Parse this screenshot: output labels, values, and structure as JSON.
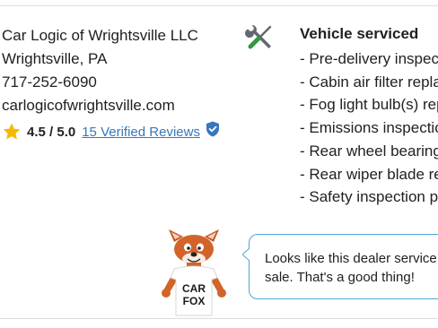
{
  "dealer": {
    "name": "Car Logic of Wrightsville LLC",
    "location": "Wrightsville, PA",
    "phone": "717-252-6090",
    "website": "carlogicofwrightsville.com",
    "rating": "4.5 / 5.0",
    "reviews_link": "15 Verified Reviews",
    "star_color": "#f5b800",
    "link_color": "#3777bc"
  },
  "service": {
    "title": "Vehicle serviced",
    "icon": "wrench-screwdriver-icon",
    "items": [
      "- Pre-delivery inspect",
      "- Cabin air filter repla",
      "- Fog light bulb(s) rep",
      "- Emissions inspectio",
      "- Rear wheel bearing",
      "- Rear wiper blade re",
      "- Safety inspection p"
    ]
  },
  "mascot": {
    "shirt_line1": "CAR",
    "shirt_line2": "FOX"
  },
  "bubble": {
    "line1": "Looks like this dealer service",
    "line2": "sale. That's a good thing!",
    "border_color": "#4fa6d6"
  }
}
